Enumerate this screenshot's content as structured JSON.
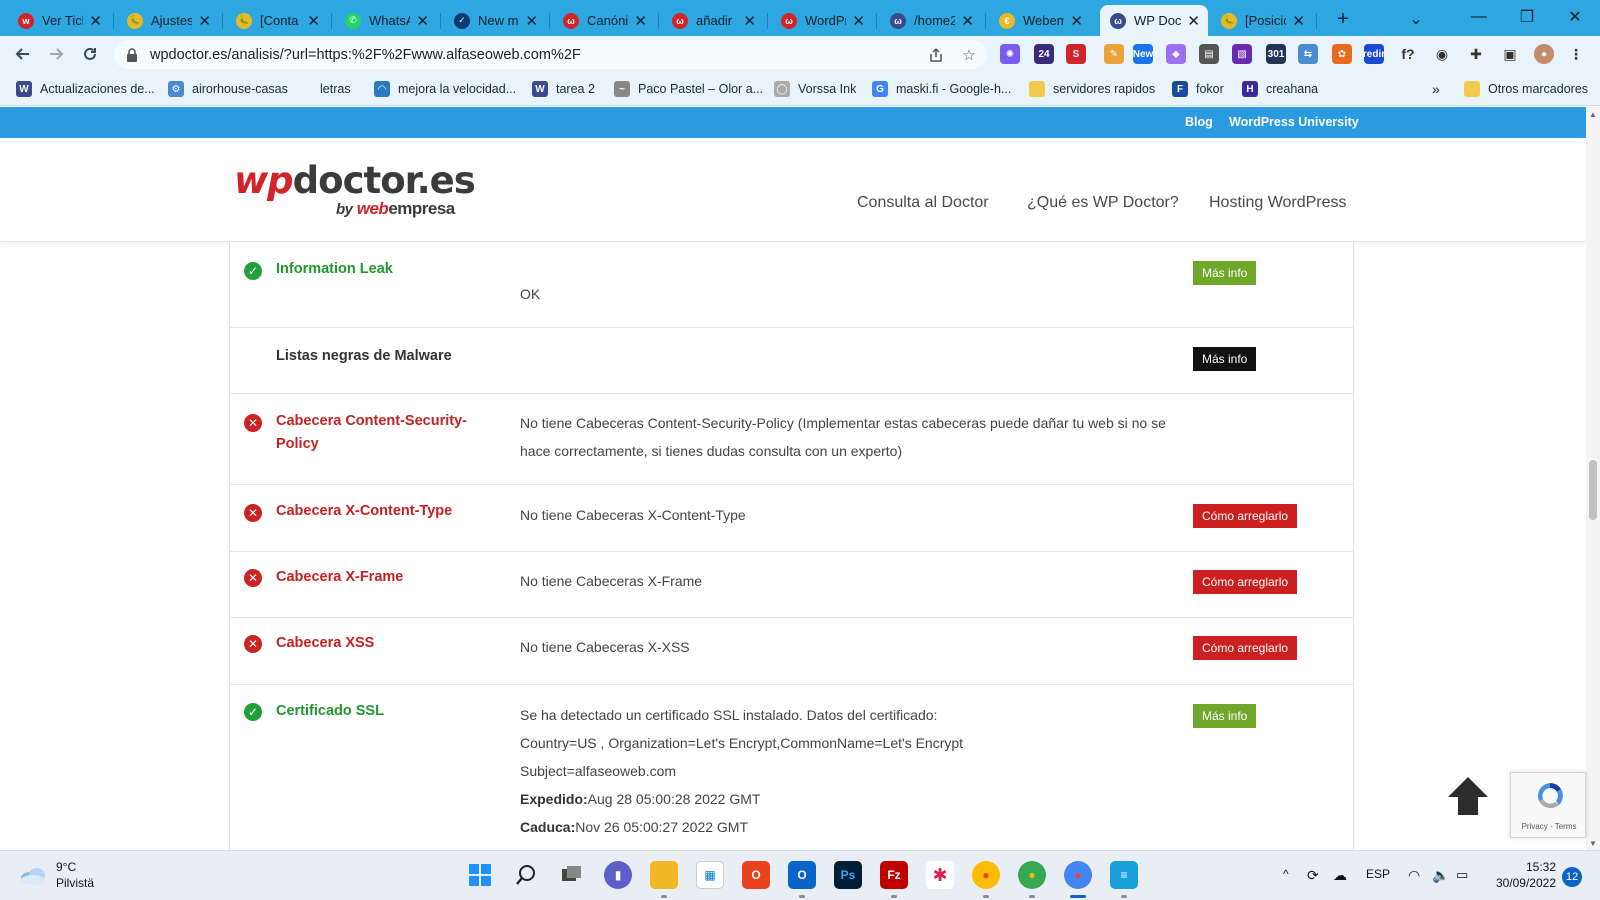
{
  "browser": {
    "tabs": [
      {
        "title": "Ver Tick",
        "favicon_color": "#d2232a",
        "favicon_char": "w"
      },
      {
        "title": "Ajustes",
        "favicon_color": "#e8b923",
        "favicon_char": "🐛"
      },
      {
        "title": "[Conta",
        "favicon_color": "#e8b923",
        "favicon_char": "🐛"
      },
      {
        "title": "WhatsA",
        "favicon_color": "#25d366",
        "favicon_char": "✆"
      },
      {
        "title": "New m",
        "favicon_color": "#0b3a6e",
        "favicon_char": "✓"
      },
      {
        "title": "Canónic",
        "favicon_color": "#d2232a",
        "favicon_char": "ω"
      },
      {
        "title": "añadir",
        "favicon_color": "#d2232a",
        "favicon_char": "ω"
      },
      {
        "title": "WordPr",
        "favicon_color": "#d2232a",
        "favicon_char": "ω"
      },
      {
        "title": "/home2",
        "favicon_color": "#3a4a8a",
        "favicon_char": "ω"
      },
      {
        "title": "Webem",
        "favicon_color": "#e8b923",
        "favicon_char": "€"
      },
      {
        "title": "WP Doc",
        "favicon_color": "#3a4a8a",
        "favicon_char": "ω",
        "active": true
      },
      {
        "title": "[Posicio",
        "favicon_color": "#e8b923",
        "favicon_char": "🐛"
      }
    ],
    "new_tab_label": "+",
    "tab_search_label": "⌄",
    "window_controls": {
      "minimize": "—",
      "restore": "❐",
      "close": "✕"
    },
    "url": "wpdoctor.es/analisis/?url=https:%2F%2Fwww.alfaseoweb.com%2F",
    "bookmarks": [
      {
        "label": "Actualizaciones de...",
        "icon_color": "#3a4a8a",
        "icon_char": "W"
      },
      {
        "label": "airorhouse-casas",
        "icon_color": "#4a8ad0",
        "icon_char": "⚙"
      },
      {
        "label": "letras",
        "icon_color": "",
        "icon_char": ""
      },
      {
        "label": "mejora la velocidad...",
        "icon_color": "#2a7ac0",
        "icon_char": "◠"
      },
      {
        "label": "tarea 2",
        "icon_color": "#3a4a8a",
        "icon_char": "W"
      },
      {
        "label": "Paco Pastel – Olor a...",
        "icon_color": "#888888",
        "icon_char": "~"
      },
      {
        "label": "Vorssa Ink",
        "icon_color": "#aaaaaa",
        "icon_char": "◯"
      },
      {
        "label": "maski.fi - Google-h...",
        "icon_color": "#4285f4",
        "icon_char": "G"
      },
      {
        "label": "servidores rapidos",
        "icon_color": "#f2c94c",
        "icon_char": ""
      },
      {
        "label": "fokor",
        "icon_color": "#1a4a9a",
        "icon_char": "F"
      },
      {
        "label": "creahana",
        "icon_color": "#3a2a9a",
        "icon_char": "H"
      }
    ],
    "more_bookmarks_label": "»",
    "other_bookmarks_label": "Otros marcadores",
    "extension_badges": [
      "24",
      "New",
      "301",
      "redir"
    ]
  },
  "site": {
    "topbar_links": [
      "Blog",
      "WordPress University"
    ],
    "logo": {
      "brand": "wpdoctor.es",
      "brand_wp": "wp",
      "brand_rest": "doctor.es",
      "by": "by",
      "by_web": "web",
      "by_rest": "empresa"
    },
    "nav": [
      "Consulta al Doctor",
      "¿Qué es WP Doctor?",
      "Hosting WordPress"
    ]
  },
  "results": [
    {
      "status": "ok",
      "label": "Information Leak",
      "desc": [
        "OK"
      ],
      "button": "Más info",
      "button_color": "green"
    },
    {
      "status": "none",
      "label": "Listas negras de Malware",
      "desc": [],
      "button": "Más info",
      "button_color": "black"
    },
    {
      "status": "err",
      "label": "Cabecera Content-Security-Policy",
      "desc": [
        "No tiene Cabeceras Content-Security-Policy (Implementar estas cabeceras puede dañar tu web si no se hace correctamente, si tienes dudas consulta con un experto)"
      ],
      "button": "",
      "button_color": ""
    },
    {
      "status": "err",
      "label": "Cabecera X-Content-Type",
      "desc": [
        "No tiene Cabeceras X-Content-Type"
      ],
      "button": "Cómo arreglarlo",
      "button_color": "red"
    },
    {
      "status": "err",
      "label": "Cabecera X-Frame",
      "desc": [
        "No tiene Cabeceras X-Frame"
      ],
      "button": "Cómo arreglarlo",
      "button_color": "red"
    },
    {
      "status": "err",
      "label": "Cabecera XSS",
      "desc": [
        "No tiene Cabeceras X-XSS"
      ],
      "button": "Cómo arreglarlo",
      "button_color": "red"
    },
    {
      "status": "ok",
      "label": "Certificado SSL",
      "desc": [
        "Se ha detectado un certificado SSL instalado. Datos del certificado:",
        "Country=US , Organization=Let's Encrypt,CommonName=Let's Encrypt",
        "Subject=alfaseoweb.com"
      ],
      "issued_label": "Expedido:",
      "issued_value": "Aug 28 05:00:28 2022 GMT",
      "expires_label": "Caduca:",
      "expires_value": "Nov 26 05:00:27 2022 GMT",
      "button": "Más info",
      "button_color": "green"
    }
  ],
  "recaptcha": {
    "links": "Privacy - Terms"
  },
  "taskbar": {
    "weather_temp": "9°C",
    "weather_desc": "Pilvistä",
    "tray_lang": "ESP",
    "time": "15:32",
    "date": "30/09/2022",
    "notifications": "12"
  }
}
